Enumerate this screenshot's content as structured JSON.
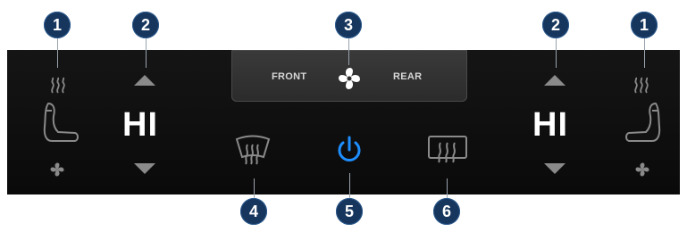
{
  "panel": {
    "mode_selector": {
      "front_label": "FRONT",
      "rear_label": "REAR",
      "icon": "fan-icon"
    },
    "left_zone": {
      "level": "HI",
      "icons": [
        "seat-heat-icon",
        "seat-icon",
        "seat-fan-icon"
      ]
    },
    "right_zone": {
      "level": "HI",
      "icons": [
        "seat-heat-icon",
        "seat-icon",
        "seat-fan-icon"
      ]
    },
    "controls": {
      "front_defrost_icon": "front-defrost-icon",
      "power_icon": "power-icon",
      "rear_defrost_icon": "rear-defrost-icon"
    },
    "colors": {
      "panel_bg": "#0f0f0f",
      "power_accent": "#1e8fff",
      "callout_badge": "#17365d"
    }
  },
  "callouts": {
    "left_seat_heat": "1",
    "left_level": "2",
    "mode": "3",
    "right_level": "2",
    "right_seat_heat": "1",
    "front_defrost": "4",
    "power": "5",
    "rear_defrost": "6"
  }
}
